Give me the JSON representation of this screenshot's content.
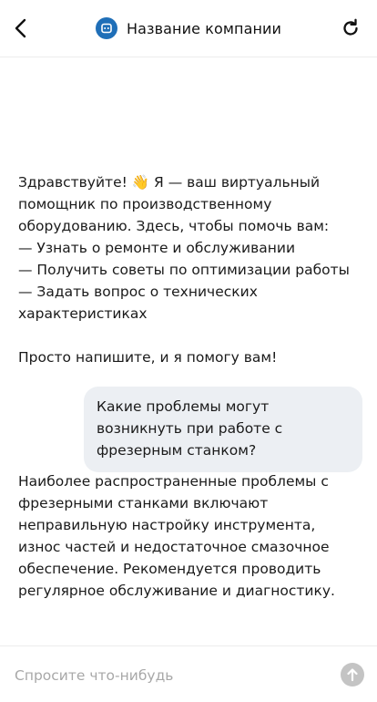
{
  "header": {
    "title": "Название компании",
    "logo_color": "#1f6fb8"
  },
  "icons": {
    "back": "chevron-left-icon",
    "refresh": "refresh-icon",
    "logo": "chat-bot-icon",
    "send": "arrow-up-icon"
  },
  "messages": {
    "welcome": {
      "line1": "Здравствуйте! 👋 Я — ваш виртуальный помощник по производственному оборудованию. Здесь, чтобы помочь вам:",
      "line2": "— Узнать о ремонте и обслуживании",
      "line3": "— Получить советы по оптимизации работы",
      "line4": "— Задать вопрос о технических характеристиках",
      "line5": "Просто напишите, и я помогу вам!"
    },
    "user_question": "Какие проблемы могут возникнуть при работе с фрезерным станком?",
    "bot_answer": "Наиболее распространенные проблемы с фрезерными станками включают неправильную настройку инструмента, износ частей и недостаточное смазочное обеспечение. Рекомендуется проводить регулярное обслуживание и диагностику."
  },
  "composer": {
    "placeholder": "Спросите что-нибудь",
    "value": ""
  },
  "colors": {
    "user_bubble": "#eceff3",
    "send_button_disabled": "#c4c4c4"
  }
}
